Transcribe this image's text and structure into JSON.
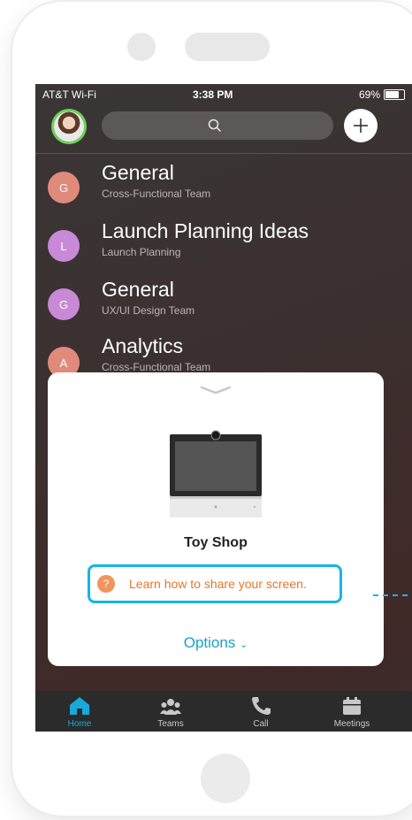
{
  "status_bar": {
    "carrier": "AT&T Wi-Fi",
    "time": "3:38 PM",
    "battery": "69%"
  },
  "header": {
    "search_icon": "search-icon",
    "add_icon": "plus-icon"
  },
  "spaces": [
    {
      "initial": "G",
      "title": "General",
      "subtitle": "Cross-Functional Team",
      "color": "#e08a7c"
    },
    {
      "initial": "L",
      "title": "Launch Planning Ideas",
      "subtitle": "Launch Planning",
      "color": "#c889d6"
    },
    {
      "initial": "G",
      "title": "General",
      "subtitle": "UX/UI Design Team",
      "color": "#c889d6"
    },
    {
      "initial": "A",
      "title": "Analytics",
      "subtitle": "Cross-Functional Team",
      "color": "#e08a7c"
    }
  ],
  "sheet": {
    "device_name": "Toy Shop",
    "help_icon_label": "?",
    "learn_link": "Learn how to share your screen.",
    "options_label": "Options",
    "options_chevron": "⌄"
  },
  "tabs": [
    {
      "label": "Home",
      "icon": "home-icon",
      "active": true
    },
    {
      "label": "Teams",
      "icon": "teams-icon",
      "active": false
    },
    {
      "label": "Call",
      "icon": "phone-icon",
      "active": false
    },
    {
      "label": "Meetings",
      "icon": "calendar-icon",
      "active": false
    }
  ],
  "colors": {
    "accent": "#14b7e0",
    "link": "#e1792c",
    "avatar_ring": "#6fcf5a"
  }
}
